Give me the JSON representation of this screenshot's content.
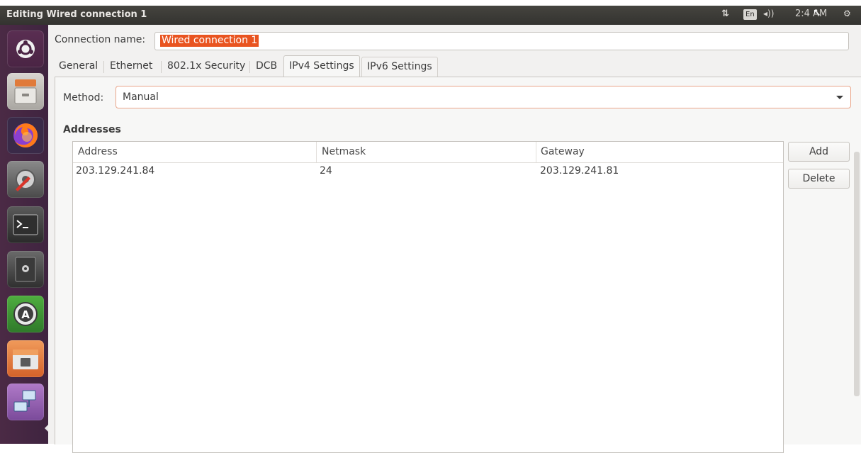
{
  "window": {
    "title": "Editing Wired connection 1"
  },
  "top_panel": {
    "network_icon": "network-arrows-icon",
    "network_glyph": "⇅",
    "keyboard_layout": "En",
    "volume_glyph": "◂))",
    "clock": "2:4 AM",
    "session_glyph": "⚙"
  },
  "launcher": {
    "items": [
      {
        "name": "ubuntu-dash",
        "icon": "ubuntu-logo-icon",
        "color": "#e95420"
      },
      {
        "name": "files",
        "icon": "file-cabinet-icon",
        "color": "#c9c6c1"
      },
      {
        "name": "firefox",
        "icon": "firefox-icon",
        "color": "#e66000"
      },
      {
        "name": "system-settings",
        "icon": "settings-wrench-icon",
        "color": "#6b6b6b"
      },
      {
        "name": "terminal",
        "icon": "terminal-icon",
        "color": "#2f2f2f"
      },
      {
        "name": "safe",
        "icon": "safe-icon",
        "color": "#3a3a3a"
      },
      {
        "name": "software-updater",
        "icon": "software-updater-icon",
        "color": "#4a9a3a"
      },
      {
        "name": "disk-manager",
        "icon": "folder-disk-icon",
        "color": "#e07a3a"
      },
      {
        "name": "network-connections",
        "icon": "network-computers-icon",
        "color": "#8a5aa6"
      }
    ]
  },
  "dialog": {
    "connection_name_label": "Connection name:",
    "connection_name_value": "Wired connection 1",
    "tabs": [
      {
        "label": "General"
      },
      {
        "label": "Ethernet"
      },
      {
        "label": "802.1x Security"
      },
      {
        "label": "DCB"
      },
      {
        "label": "IPv4 Settings",
        "active": true
      },
      {
        "label": "IPv6 Settings"
      }
    ],
    "method_label": "Method:",
    "method_value": "Manual",
    "addresses_heading": "Addresses",
    "table": {
      "columns": [
        "Address",
        "Netmask",
        "Gateway"
      ],
      "rows": [
        [
          "203.129.241.84",
          "24",
          "203.129.241.81"
        ]
      ]
    },
    "add_button": "Add",
    "delete_button": "Delete"
  },
  "colors": {
    "accent": "#e95420",
    "launcher_bg": "#4b2a45",
    "panel_bg": "#3c3b37"
  }
}
